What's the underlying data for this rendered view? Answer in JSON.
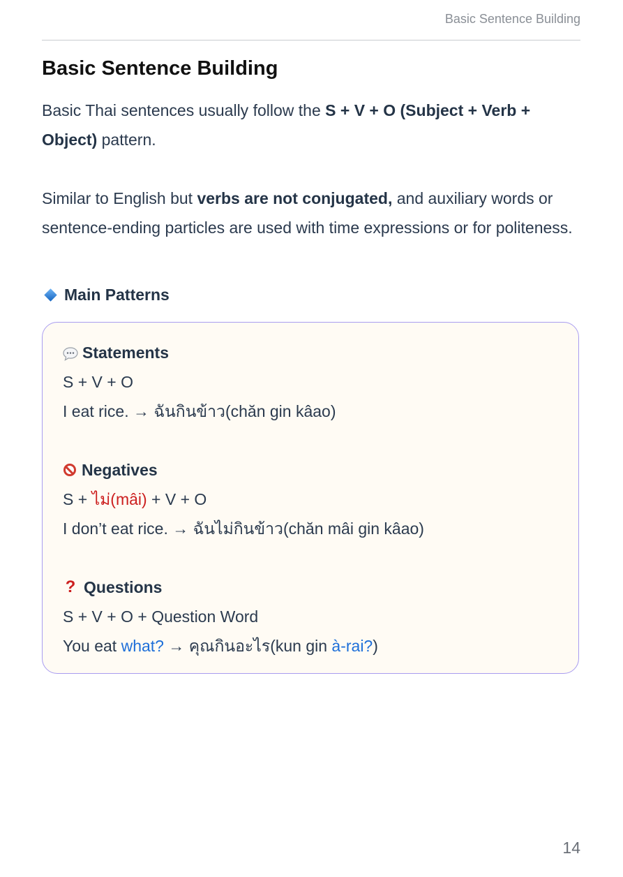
{
  "header": {
    "running_title": "Basic Sentence Building"
  },
  "page": {
    "title": "Basic Sentence Building",
    "intro": {
      "p1_before": "Basic Thai sentences usually follow the ",
      "p1_bold": "S + V + O (Subject + Verb + Object)",
      "p1_after": " pattern.",
      "p2_before": "Similar to English but ",
      "p2_bold": "verbs are not conjugated,",
      "p2_after": " and auxiliary words or sentence-ending particles are used with time expressions or for politeness."
    },
    "section": {
      "icon": "blue-diamond-icon",
      "title": "Main Patterns"
    },
    "statements": {
      "icon": "speech-bubble-icon",
      "title": "Statements",
      "pattern": "S + V + O",
      "example": "I eat rice. → ฉันกินข้าว(chăn gin kâao)"
    },
    "negatives": {
      "icon": "prohibited-icon",
      "title": "Negatives",
      "pattern_before": "S + ",
      "pattern_highlight": "ไม่(mâi)",
      "pattern_after": " + V + O",
      "example": "I don’t eat rice. → ฉันไม่กินข้าว(chăn mâi gin kâao)"
    },
    "questions": {
      "icon": "question-mark-icon",
      "title": "Questions",
      "pattern": "S + V + O + Question Word",
      "example_before": "You eat ",
      "example_highlight1": "what?",
      "example_middle": " → คุณกินอะไร(kun gin ",
      "example_highlight2": "à-rai?",
      "example_after": ")"
    },
    "page_number": "14"
  },
  "colors": {
    "negative_highlight": "#cc1f1f",
    "question_highlight": "#1e6fd9",
    "card_background": "#fffbf4",
    "card_border": "#a99cf0"
  }
}
